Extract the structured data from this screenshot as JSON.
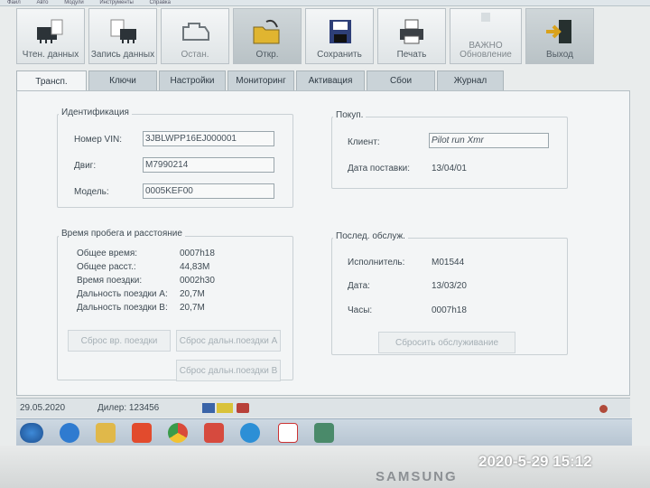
{
  "window": {
    "menu": [
      "Файл",
      "Авто",
      "Модули",
      "Инструменты",
      "Справка"
    ]
  },
  "toolbar": [
    {
      "label": "Чтен. данных",
      "icon": "read-data-icon"
    },
    {
      "label": "Запись данных",
      "icon": "write-data-icon"
    },
    {
      "label": "Остан.",
      "icon": "engine-stop-icon"
    },
    {
      "label": "Откр.",
      "icon": "open-folder-icon"
    },
    {
      "label": "Сохранить",
      "icon": "floppy-save-icon"
    },
    {
      "label": "Печать",
      "icon": "printer-icon"
    },
    {
      "label": "ВАЖНО\nОбновление",
      "icon": "update-icon"
    },
    {
      "label": "Выход",
      "icon": "exit-door-icon"
    }
  ],
  "tabs": [
    "Трансп.",
    "Ключи",
    "Настройки",
    "Мониторинг",
    "Активация",
    "Сбои",
    "Журнал"
  ],
  "ident": {
    "title": "Идентификация",
    "vin_label": "Номер VIN:",
    "vin_value": "3JBLWPP16EJ000001",
    "engine_label": "Двиг:",
    "engine_value": "M7990214",
    "model_label": "Модель:",
    "model_value": "0005KEF00"
  },
  "purchase": {
    "title": "Покуп.",
    "client_label": "Клиент:",
    "client_value": "Pilot run Xmr",
    "date_label": "Дата поставки:",
    "date_value": "13/04/01"
  },
  "mileage": {
    "title": "Время пробега и расстояние",
    "rows": [
      {
        "label": "Общее время:",
        "value": "0007h18"
      },
      {
        "label": "Общее расст.:",
        "value": "44,83M"
      },
      {
        "label": "Время поездки:",
        "value": "0002h30"
      },
      {
        "label": "Дальность поездки А:",
        "value": "20,7M"
      },
      {
        "label": "Дальность поездки B:",
        "value": "20,7M"
      }
    ],
    "btn_reset_time": "Сброс вр. поездки",
    "btn_reset_a": "Сброс дальн.поездки А",
    "btn_reset_b": "Сброс дальн.поездки B"
  },
  "service": {
    "title": "Послед. обслуж.",
    "executor_label": "Исполнитель:",
    "executor_value": "M01544",
    "date_label": "Дата:",
    "date_value": "13/03/20",
    "hours_label": "Часы:",
    "hours_value": "0007h18",
    "btn_reset": "Сбросить обслуживание"
  },
  "status": {
    "date": "29.05.2020",
    "dealer": "Дилер: 123456"
  },
  "bezel": {
    "brand": "SAMSUNG",
    "photo_stamp": "2020-5-29 15:12"
  }
}
